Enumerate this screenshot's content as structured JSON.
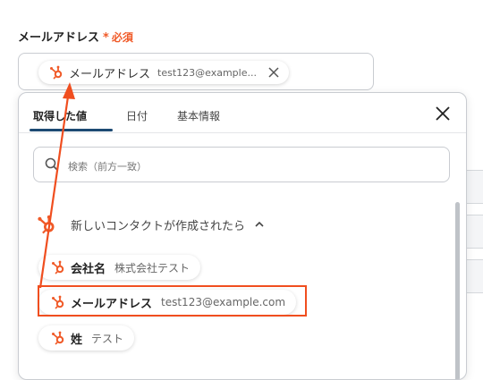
{
  "field": {
    "label": "メールアドレス",
    "required_mark": "*",
    "required_text": "必須",
    "chip_label": "メールアドレス",
    "chip_value": "test123@example...",
    "chip_remove_icon": "close-icon"
  },
  "tabs": [
    {
      "label": "取得した値",
      "active": true
    },
    {
      "label": "日付",
      "active": false
    },
    {
      "label": "基本情報",
      "active": false
    }
  ],
  "search": {
    "placeholder": "検索（前方一致）",
    "icon": "search-icon"
  },
  "group": {
    "label": "新しいコンタクトが作成されたら",
    "icon": "hubspot-icon",
    "chevron": "chevron-up-icon"
  },
  "items": [
    {
      "label": "会社名",
      "value": "株式会社テスト",
      "icon": "hubspot-icon"
    },
    {
      "label": "メールアドレス",
      "value": "test123@example.com",
      "icon": "hubspot-icon"
    },
    {
      "label": "姓",
      "value": "テスト",
      "icon": "hubspot-icon"
    }
  ],
  "colors": {
    "accent": "#f05a28",
    "tab_underline": "#1d4a73",
    "annotation": "#f04e1f"
  }
}
